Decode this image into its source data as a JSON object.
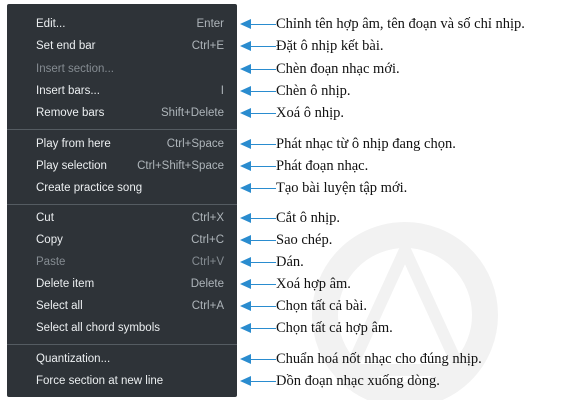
{
  "menu": {
    "items": [
      {
        "label": "Edit...",
        "shortcut": "Enter",
        "disabled": false
      },
      {
        "label": "Set end bar",
        "shortcut": "Ctrl+E",
        "disabled": false
      },
      {
        "label": "Insert section...",
        "shortcut": "",
        "disabled": true
      },
      {
        "label": "Insert bars...",
        "shortcut": "I",
        "disabled": false
      },
      {
        "label": "Remove bars",
        "shortcut": "Shift+Delete",
        "disabled": false
      },
      {
        "label": "Play from here",
        "shortcut": "Ctrl+Space",
        "disabled": false
      },
      {
        "label": "Play selection",
        "shortcut": "Ctrl+Shift+Space",
        "disabled": false
      },
      {
        "label": "Create practice song",
        "shortcut": "",
        "disabled": false
      },
      {
        "label": "Cut",
        "shortcut": "Ctrl+X",
        "disabled": false
      },
      {
        "label": "Copy",
        "shortcut": "Ctrl+C",
        "disabled": false
      },
      {
        "label": "Paste",
        "shortcut": "Ctrl+V",
        "disabled": true
      },
      {
        "label": "Delete item",
        "shortcut": "Delete",
        "disabled": false
      },
      {
        "label": "Select all",
        "shortcut": "Ctrl+A",
        "disabled": false
      },
      {
        "label": "Select all chord symbols",
        "shortcut": "",
        "disabled": false
      },
      {
        "label": "Quantization...",
        "shortcut": "",
        "disabled": false
      },
      {
        "label": "Force section at new line",
        "shortcut": "",
        "disabled": false
      }
    ]
  },
  "annotations": [
    "Chỉnh tên hợp âm, tên đoạn và số chỉ nhịp.",
    "Đặt ô nhịp kết bài.",
    "Chèn đoạn nhạc mới.",
    "Chèn ô nhịp.",
    "Xoá ô nhịp.",
    "Phát nhạc từ ô nhịp đang chọn.",
    "Phát đoạn nhạc.",
    "Tạo bài luyện tập mới.",
    "Cắt ô nhịp.",
    "Sao chép.",
    "Dán.",
    "Xoá hợp âm.",
    "Chọn tất cả bài.",
    "Chọn tất cả hợp âm.",
    "Chuẩn hoá nốt nhạc cho đúng nhịp.",
    "Dồn đoạn nhạc xuống dòng."
  ],
  "colors": {
    "menu_bg": "#2e3338",
    "arrow": "#2a8ccf"
  }
}
